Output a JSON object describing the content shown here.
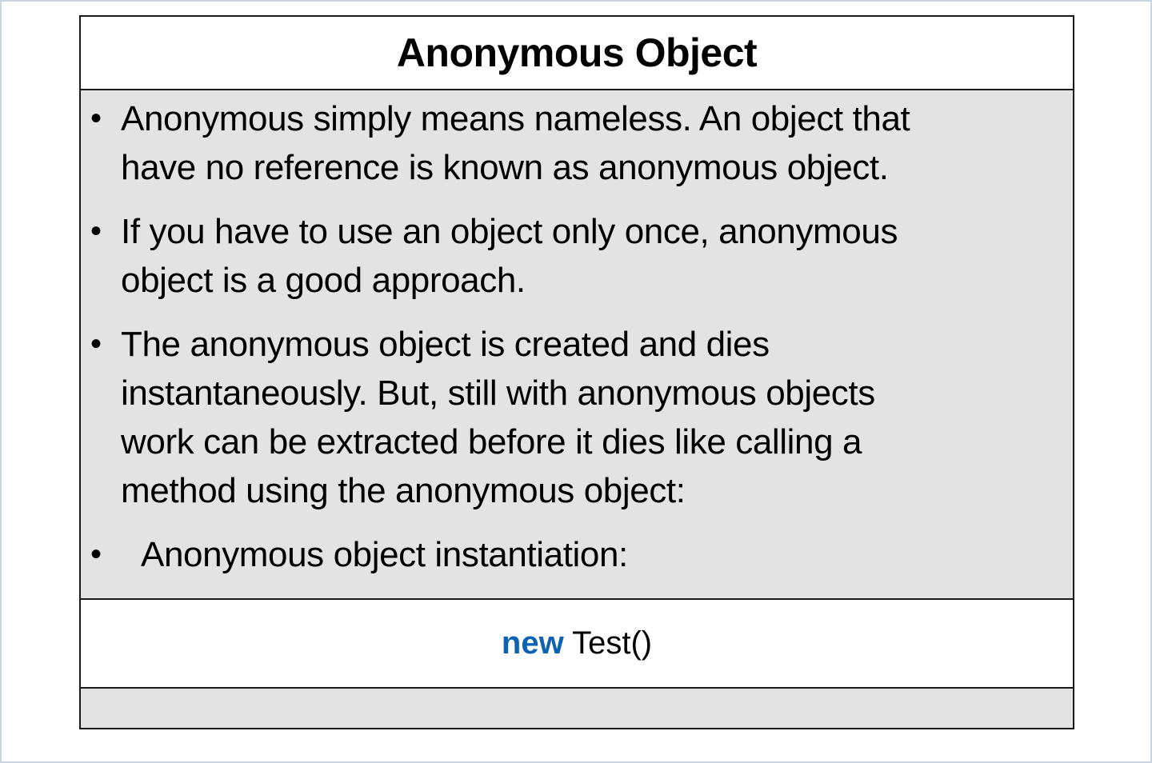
{
  "slide": {
    "title": "Anonymous Object",
    "bullet_symbol": "•",
    "bullets": [
      "Anonymous simply means nameless. An object that\nhave no reference is known as anonymous object.",
      "If you have to use an object only once, anonymous\nobject is a good approach.",
      "The anonymous object is created and dies\ninstantaneously. But, still  with anonymous objects\nwork can be extracted before it dies like calling a\nmethod using the anonymous object:",
      "Anonymous object instantiation:"
    ],
    "code": {
      "keyword": "new",
      "rest": " Test()"
    }
  },
  "colors": {
    "body_background": "#e3e3e3",
    "border": "#1a1a1a",
    "keyword": "#0d63b3"
  }
}
